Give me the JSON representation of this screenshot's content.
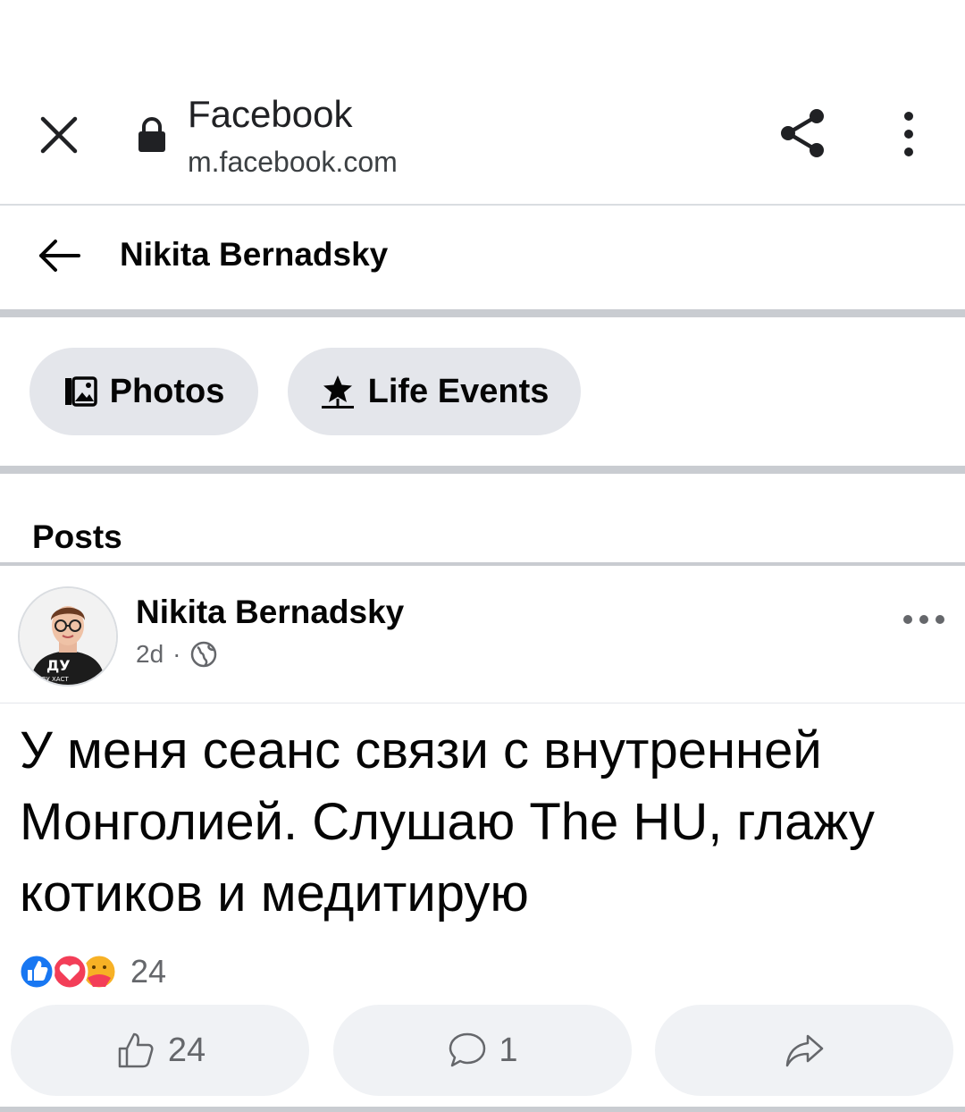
{
  "browser": {
    "site_title": "Facebook",
    "site_url": "m.facebook.com"
  },
  "header": {
    "profile_name": "Nikita Bernadsky"
  },
  "tabs": [
    {
      "label": "Photos",
      "icon": "photos-icon"
    },
    {
      "label": "Life Events",
      "icon": "star-icon"
    }
  ],
  "posts_section": {
    "heading": "Posts"
  },
  "post": {
    "author": "Nikita Bernadsky",
    "time": "2d",
    "separator": "·",
    "privacy_icon": "globe-icon",
    "avatar_shirt_text": "ДУ",
    "avatar_shirt_subtext": "ДУ ХАСТ",
    "text": "У меня сеанс связи с внутренней Монголией. Слушаю The HU, глажу котиков и медитирую",
    "reaction_icons": [
      "like-reaction-icon",
      "love-reaction-icon",
      "care-reaction-icon"
    ],
    "reaction_count": "24",
    "actions": {
      "like_count": "24",
      "comment_count": "1"
    }
  },
  "colors": {
    "facebook_blue": "#1877f2",
    "love_red": "#f33e58",
    "care_yellow": "#f7b125",
    "pill_gray": "#e4e6eb",
    "secondary_text": "#65676b"
  }
}
